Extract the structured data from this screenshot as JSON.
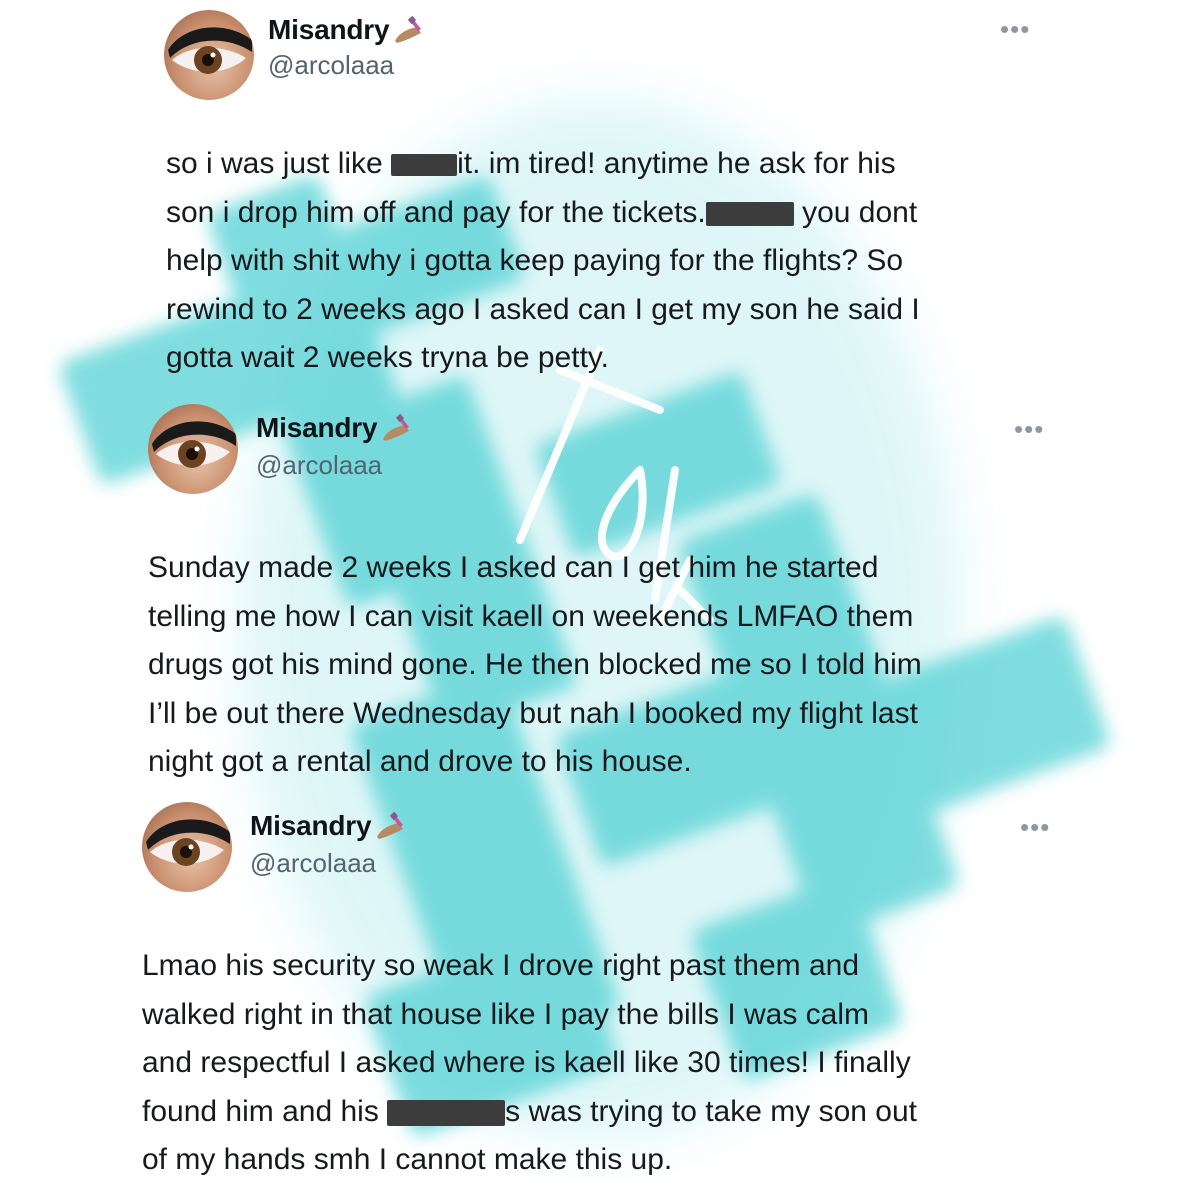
{
  "tweets": [
    {
      "display_name": "Misandry",
      "handle": "@arcolaaa",
      "more_label": "•••",
      "lines": [
        [
          "so i was just like ",
          "[redacted]",
          "it. im tired! anytime he ask for his"
        ],
        [
          "son i drop him off and pay for the tickets.",
          "[redacted]",
          " you dont"
        ],
        [
          "help with shit why i gotta keep paying for the flights? So"
        ],
        [
          "rewind to 2 weeks ago I asked can I get my son he said I"
        ],
        [
          "gotta wait 2 weeks tryna be petty."
        ]
      ]
    },
    {
      "display_name": "Misandry",
      "handle": "@arcolaaa",
      "more_label": "•••",
      "lines": [
        [
          "Sunday made 2 weeks I asked can I get him he started"
        ],
        [
          "telling me how I can visit kaell on weekends LMFAO them"
        ],
        [
          "drugs got his mind gone. He then blocked me so I told him"
        ],
        [
          "I’ll be out there Wednesday but nah I booked my flight last"
        ],
        [
          "night got a rental and drove to his house."
        ]
      ]
    },
    {
      "display_name": "Misandry",
      "handle": "@arcolaaa",
      "more_label": "•••",
      "lines": [
        [
          "Lmao his security so weak I drove right past them and"
        ],
        [
          "walked right in that house like I pay the bills I was calm"
        ],
        [
          "and respectful I asked where is kaell like 30 times! I finally"
        ],
        [
          "found him and his ",
          "[redacted]",
          "s was trying to take my son out"
        ],
        [
          "of my hands smh I cannot make this up."
        ]
      ]
    }
  ],
  "icons": {
    "name_emoji": "nail-polish-icon",
    "more": "more-options-icon",
    "avatar": "eye-avatar"
  },
  "colors": {
    "watermark": "#4fd0d4",
    "redaction": "#3c3c3c",
    "handle": "#536471",
    "text": "#17191c"
  }
}
